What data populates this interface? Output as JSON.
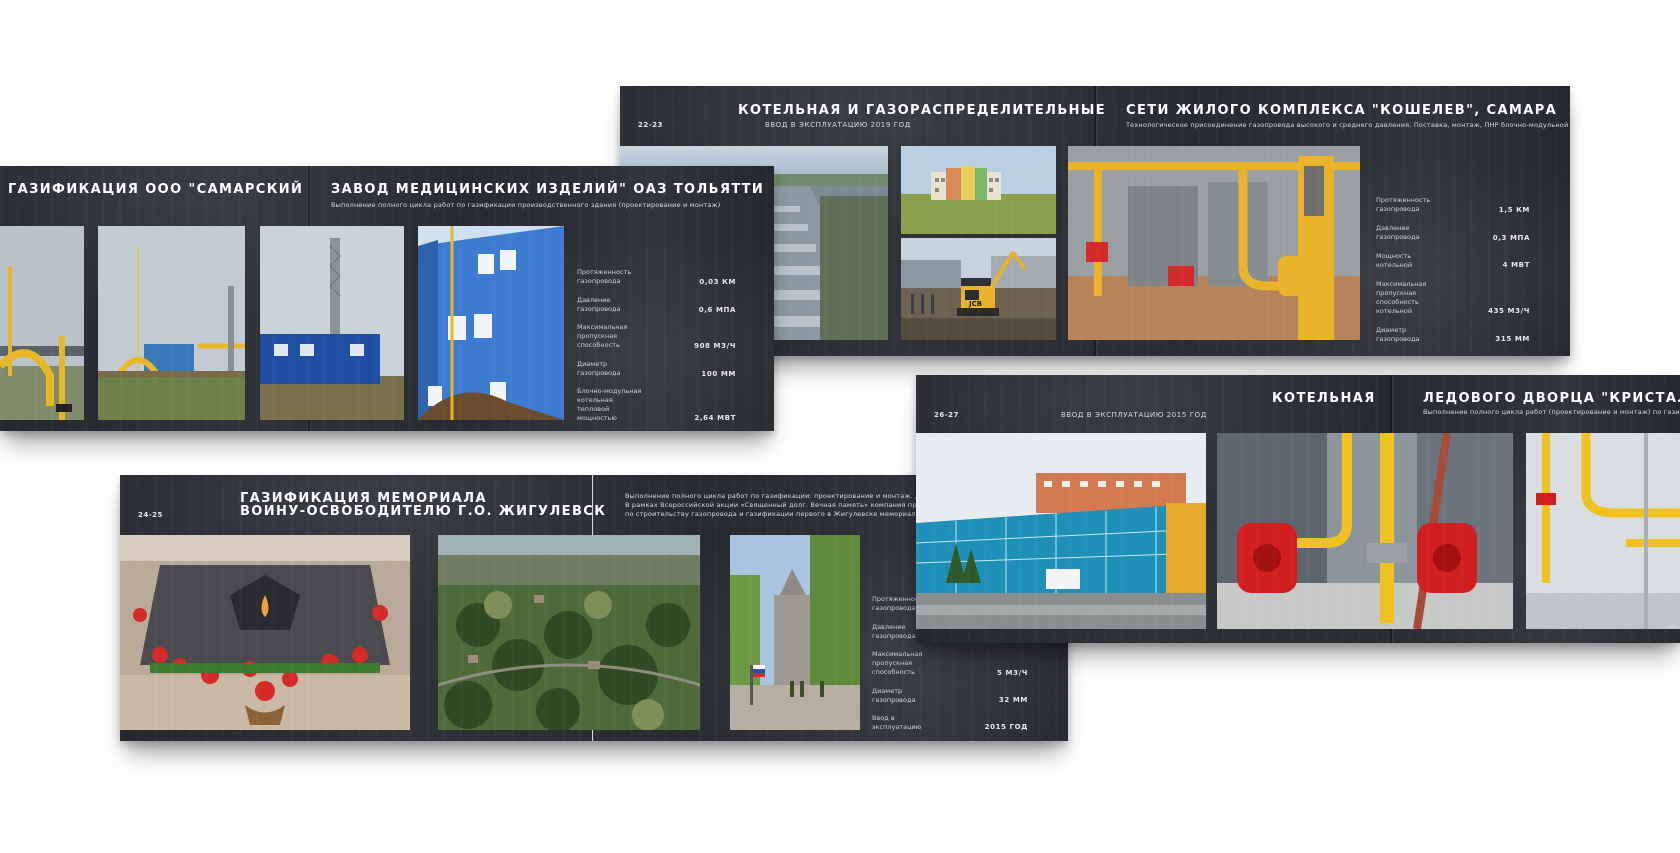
{
  "spread_22_23": {
    "page_num": "22-23",
    "title_left": "КОТЕЛЬНАЯ И ГАЗОРАСПРЕДЕЛИТЕЛЬНЫЕ",
    "subtitle_left": "ВВОД В ЭКСПЛУАТАЦИЮ 2019 ГОД",
    "title_right": "СЕТИ ЖИЛОГО КОМПЛЕКСА \"КОШЕЛЕВ\", САМАРА",
    "description": "Технологическое присоединение газопровода высокого и среднего давления. Поставка, монтаж, ПНР блочно-модульной котельной.",
    "specs": [
      {
        "label": "Протяженность газопровода",
        "value": "1,5 КМ"
      },
      {
        "label": "Давление газопровода",
        "value": "0,3 МПА"
      },
      {
        "label": "Мощность котельной",
        "value": "4 МВТ"
      },
      {
        "label": "Максимальная пропускная способность котельной",
        "value": "435 М3/Ч"
      },
      {
        "label": "Диаметр газопровода",
        "value": "315 ММ"
      }
    ]
  },
  "spread_tolyatti": {
    "title_left": "ГАЗИФИКАЦИЯ ООО \"САМАРСКИЙ",
    "title_right": "ЗАВОД МЕДИЦИНСКИХ ИЗДЕЛИЙ\" ОАЗ ТОЛЬЯТТИ",
    "description": "Выполнение полного цикла работ по газификации производственного здания (проектирование и монтаж)",
    "specs": [
      {
        "label": "Протяженность газопровода",
        "value": "0,03 КМ"
      },
      {
        "label": "Давление газопровода",
        "value": "0,6 МПА"
      },
      {
        "label": "Максимальная пропускная способность",
        "value": "908 М3/Ч"
      },
      {
        "label": "Диаметр газопровода",
        "value": "100 ММ"
      },
      {
        "label": "Блочно-модульная котельная тепловой мощностью",
        "value": "2,64 МВТ"
      }
    ]
  },
  "spread_24_25": {
    "page_num": "24-25",
    "title_line1": "ГАЗИФИКАЦИЯ МЕМОРИАЛА",
    "title_line2": "ВОИНУ-ОСВОБОДИТЕЛЮ Г.О. ЖИГУЛЕВСК",
    "desc_line1": "Выполнение полного цикла работ по газификации: проектирование и монтаж. Дальнейш",
    "desc_line2": "В рамках Всероссийской акции «Священный долг. Вечная память» компания провела рабо",
    "desc_line3": "по строительству газопровода и газификации первого в Жигулевске мемориального комп",
    "specs": [
      {
        "label": "Протяженность газопровода",
        "value": ""
      },
      {
        "label": "Давление газопровода",
        "value": ""
      },
      {
        "label": "Максимальная пропускная способность",
        "value": "5 М3/Ч"
      },
      {
        "label": "Диаметр газопровода",
        "value": "32 ММ"
      },
      {
        "label": "Ввод в эксплуатацию",
        "value": "2015 ГОД"
      }
    ]
  },
  "spread_26_27": {
    "page_num": "26-27",
    "subtitle_left": "ВВОД В ЭКСПЛУАТАЦИЮ 2015 ГОД",
    "title_left": "КОТЕЛЬНАЯ",
    "title_right": "ЛЕДОВОГО ДВОРЦА \"КРИСТАЛЛ\"",
    "description": "Выполнение полного цикла работ (проектирование и монтаж) по газификации",
    "cut_text": "Мо"
  }
}
